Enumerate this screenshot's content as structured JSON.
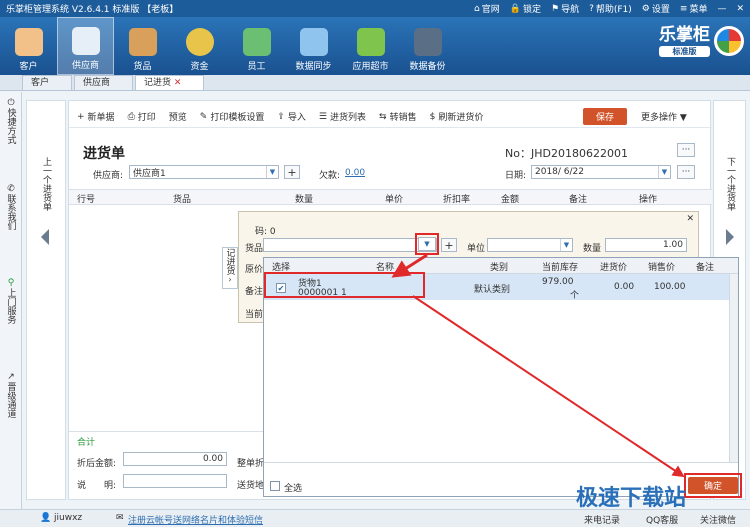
{
  "titlebar": {
    "title": "乐掌柜管理系统 V2.6.4.1 标准版 【老板】",
    "menu": [
      "官网",
      "锁定",
      "导航",
      "帮助(F1)",
      "设置",
      "菜单"
    ]
  },
  "ribbon": {
    "items": [
      "客户",
      "供应商",
      "货品",
      "资金",
      "员工",
      "数据同步",
      "应用超市",
      "数据备份"
    ],
    "brand": "乐掌柜",
    "brand_sub": "标准版"
  },
  "tabs": [
    "客户",
    "供应商",
    "记进货"
  ],
  "side_left": [
    "快捷方式",
    "联系我们",
    "上门服务",
    "晋级通道"
  ],
  "nav": {
    "prev": "上一个进货单",
    "next": "下一个进货单"
  },
  "toolbar": {
    "items": [
      "新单据",
      "打印",
      "预览",
      "打印模板设置",
      "导入",
      "进货列表",
      "转销售",
      "刷新进货价"
    ],
    "save": "保存",
    "more": "更多操作"
  },
  "doc": {
    "title": "进货单",
    "no_label": "No：",
    "no_value": "JHD20180622001",
    "supplier_label": "供应商:",
    "supplier_value": "供应商1",
    "debt_label": "欠款:",
    "debt_value": "0.00",
    "date_label": "日期:",
    "date_value": "2018/ 6/22"
  },
  "grid_head": [
    "行号",
    "货品",
    "数量",
    "单价",
    "折扣率",
    "金额",
    "备注",
    "操作"
  ],
  "totals": {
    "label": "合计",
    "after_discount_label": "折后金额:",
    "after_discount_value": "0.00",
    "whole_discount_label": "整单折",
    "note_label": "说　　明:",
    "delivery_label": "送货地"
  },
  "side_tag": "记进货",
  "popup": {
    "code_label": "码: 0",
    "product_label": "货品",
    "unit_label": "单位",
    "qty_label": "数量",
    "qty_value": "1.00",
    "orig_price_label": "原价",
    "remark_label": "备注",
    "current_label": "当前"
  },
  "dropdown": {
    "headers": [
      "选择",
      "名称",
      "类别",
      "当前库存",
      "进货价",
      "销售价",
      "备注"
    ],
    "row": {
      "name": "货物1",
      "code": "0000001 1",
      "category": "默认类别",
      "stock": "979.00",
      "stock_unit": "个",
      "buy_price": "0.00",
      "sell_price": "100.00"
    },
    "select_all": "全选",
    "confirm": "确定"
  },
  "statusbar": {
    "user": "jiuwxz",
    "register": "注册云帐号送网络名片和体验短信",
    "calls": "来电记录",
    "qq": "QQ客服",
    "wechat": "关注微信"
  },
  "watermark": "极速下载站"
}
